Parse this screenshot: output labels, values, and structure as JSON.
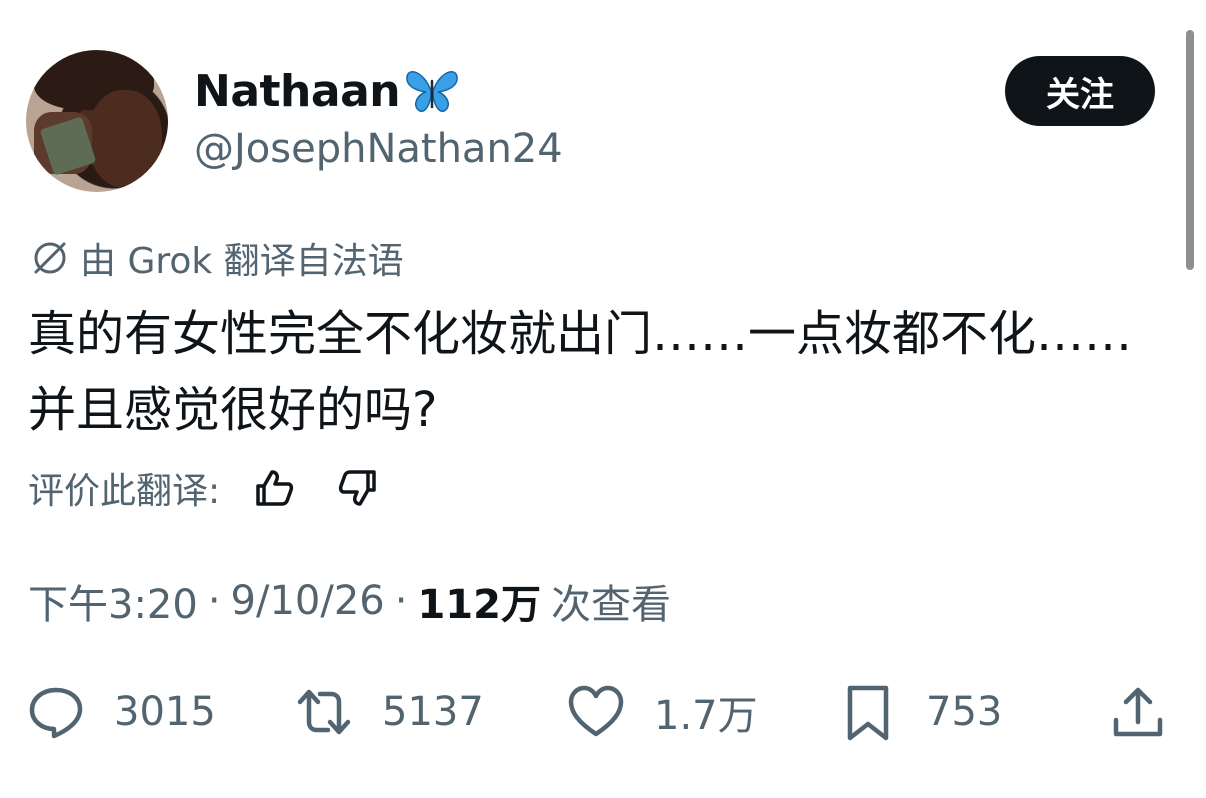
{
  "user": {
    "display_name": "Nathaan",
    "name_emoji": "butterfly-emoji",
    "handle": "@JosephNathan24",
    "avatar": "profile-photo"
  },
  "follow_button": {
    "label": "关注"
  },
  "translation": {
    "icon": "translate-icon",
    "label": "由 Grok 翻译自法语"
  },
  "tweet": {
    "text": "真的有女性完全不化妆就出门……一点妆都不化……并且感觉很好的吗?"
  },
  "rating": {
    "label": "评价此翻译:",
    "up_icon": "thumbs-up-icon",
    "down_icon": "thumbs-down-icon"
  },
  "meta": {
    "time": "下午3:20",
    "separator": "·",
    "date": "9/10/26",
    "views_count": "112万",
    "views_label": "次查看"
  },
  "actions": {
    "replies": "3015",
    "retweets": "5137",
    "likes": "1.7万",
    "bookmarks": "753"
  },
  "colors": {
    "text_primary": "#0f1419",
    "text_secondary": "#536471",
    "button_bg": "#0f1419",
    "butterfly": "#3aa0e6"
  }
}
